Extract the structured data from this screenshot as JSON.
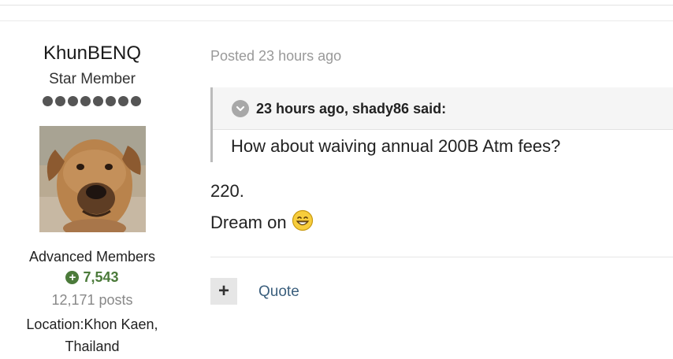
{
  "author": {
    "name": "KhunBENQ",
    "title": "Star Member",
    "pips": 8,
    "group": "Advanced Members",
    "reputation": "7,543",
    "posts": "12,171 posts",
    "location_line1": "Location:Khon Kaen,",
    "location_line2": "Thailand"
  },
  "post": {
    "posted": "Posted 23 hours ago",
    "quote_header": "23 hours ago, shady86 said:",
    "quote_text": "How about waiving annual 200B Atm fees?",
    "line1": "220.",
    "line2": "Dream on",
    "emoji": "grinning-face-icon"
  },
  "actions": {
    "plus_label": "+",
    "quote_label": "Quote"
  },
  "colors": {
    "reputation": "#4b7a3a",
    "link": "#3b5f7d",
    "quote_border": "#bbbbbb"
  }
}
